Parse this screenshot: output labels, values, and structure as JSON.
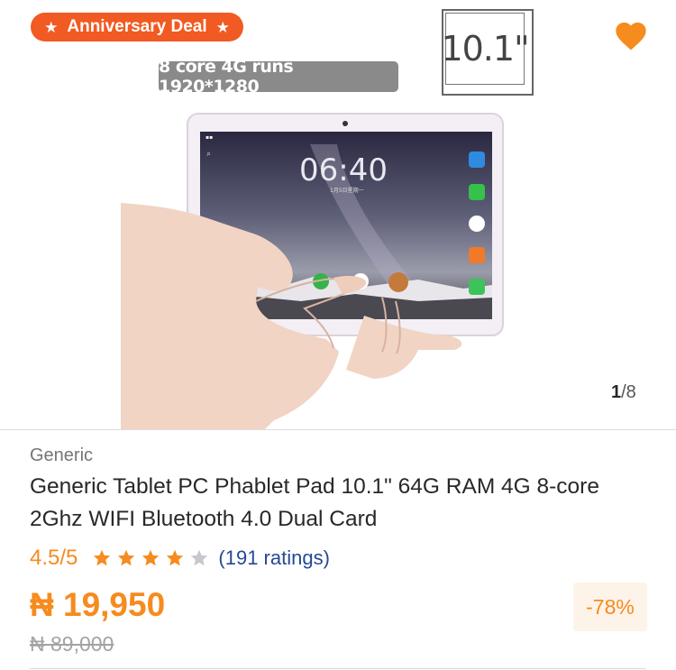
{
  "gallery": {
    "deal_badge": "Anniversary Deal",
    "spec_banner": "8 core 4G runs 1920*1280",
    "size_label": "10.1\"",
    "screen_time": "06:40",
    "counter_current": "1",
    "counter_total": "/8",
    "favorite_icon": "heart-icon",
    "favorite_color": "#f68b1e"
  },
  "product": {
    "brand": "Generic",
    "title": "Generic Tablet PC Phablet Pad 10.1\" 64G RAM 4G 8-core 2Ghz WIFI Bluetooth 4.0 Dual Card",
    "rating_value": "4.5",
    "rating_scale": "/5",
    "rating_stars": 4.5,
    "rating_count": "(191 ratings)",
    "price": "₦ 19,950",
    "old_price": "₦ 89,000",
    "discount": "-78%"
  },
  "colors": {
    "accent": "#f68b1e",
    "deal_badge": "#f15a22",
    "link": "#264996"
  }
}
